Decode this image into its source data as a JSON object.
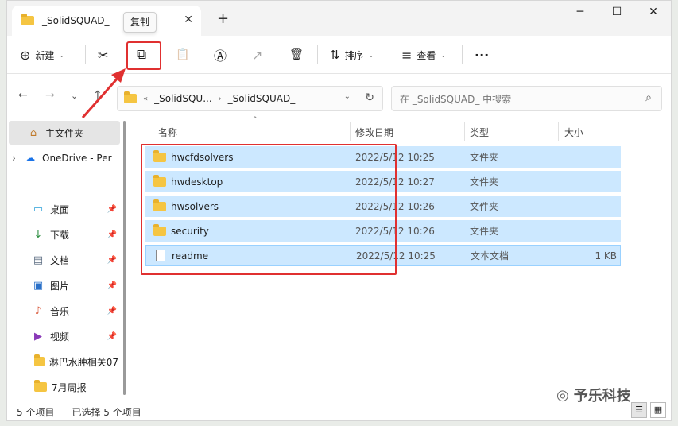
{
  "window": {
    "tab_title": "_SolidSQUAD_",
    "tab_close": "✕",
    "new_tab": "+",
    "min": "─",
    "max": "☐",
    "close": "✕"
  },
  "tooltip": "复制",
  "toolbar": {
    "new_label": "新建",
    "new_icon": "⊕",
    "cut_icon": "✂",
    "copy_icon": "⧉",
    "paste_icon": "📋",
    "rename_icon": "Ⓐ",
    "share_icon": "↗",
    "delete_icon": "🗑",
    "sort_label": "排序",
    "sort_icon": "⇅",
    "view_label": "查看",
    "view_icon": "≡",
    "more_icon": "···",
    "caret": "⌄"
  },
  "address": {
    "back": "←",
    "forward": "→",
    "dropdown": "⌄",
    "up": "↑",
    "overflow": "«",
    "seg1": "_SolidSQU...",
    "seg2": "_SolidSQUAD_",
    "chevron": "›",
    "refresh": "↻",
    "search_placeholder": "在 _SolidSQUAD_ 中搜索",
    "search_icon": "⌕"
  },
  "sidebar": {
    "items": [
      {
        "label": "主文件夹",
        "icon": "⌂",
        "pin": ""
      },
      {
        "label": "OneDrive - Per",
        "icon": "☁",
        "pin": "",
        "expander": "›"
      },
      {
        "label": "桌面",
        "icon": "▭",
        "pin": "📌"
      },
      {
        "label": "下载",
        "icon": "↓",
        "pin": "📌"
      },
      {
        "label": "文档",
        "icon": "▤",
        "pin": "📌"
      },
      {
        "label": "图片",
        "icon": "▣",
        "pin": "📌"
      },
      {
        "label": "音乐",
        "icon": "♪",
        "pin": "📌"
      },
      {
        "label": "视频",
        "icon": "▶",
        "pin": "📌"
      },
      {
        "label": "淋巴水肿相关07",
        "icon": "folder",
        "pin": ""
      },
      {
        "label": "7月周报",
        "icon": "folder",
        "pin": ""
      }
    ]
  },
  "columns": {
    "name": "名称",
    "date": "修改日期",
    "type": "类型",
    "size": "大小",
    "sort_arrow": "^"
  },
  "files": [
    {
      "name": "hwcfdsolvers",
      "date": "2022/5/12 10:25",
      "type": "文件夹",
      "size": "",
      "kind": "folder"
    },
    {
      "name": "hwdesktop",
      "date": "2022/5/12 10:27",
      "type": "文件夹",
      "size": "",
      "kind": "folder"
    },
    {
      "name": "hwsolvers",
      "date": "2022/5/12 10:26",
      "type": "文件夹",
      "size": "",
      "kind": "folder"
    },
    {
      "name": "security",
      "date": "2022/5/12 10:26",
      "type": "文件夹",
      "size": "",
      "kind": "folder"
    },
    {
      "name": "readme",
      "date": "2022/5/12 10:25",
      "type": "文本文档",
      "size": "1 KB",
      "kind": "doc"
    }
  ],
  "status": {
    "count": "5 个项目",
    "selected": "已选择 5 个项目",
    "details_view": "☰",
    "tiles_view": "▦"
  },
  "watermark": {
    "icon": "◎",
    "text": "予乐科技"
  },
  "colors": {
    "selection": "#cce8ff",
    "annotation": "#e03030"
  }
}
